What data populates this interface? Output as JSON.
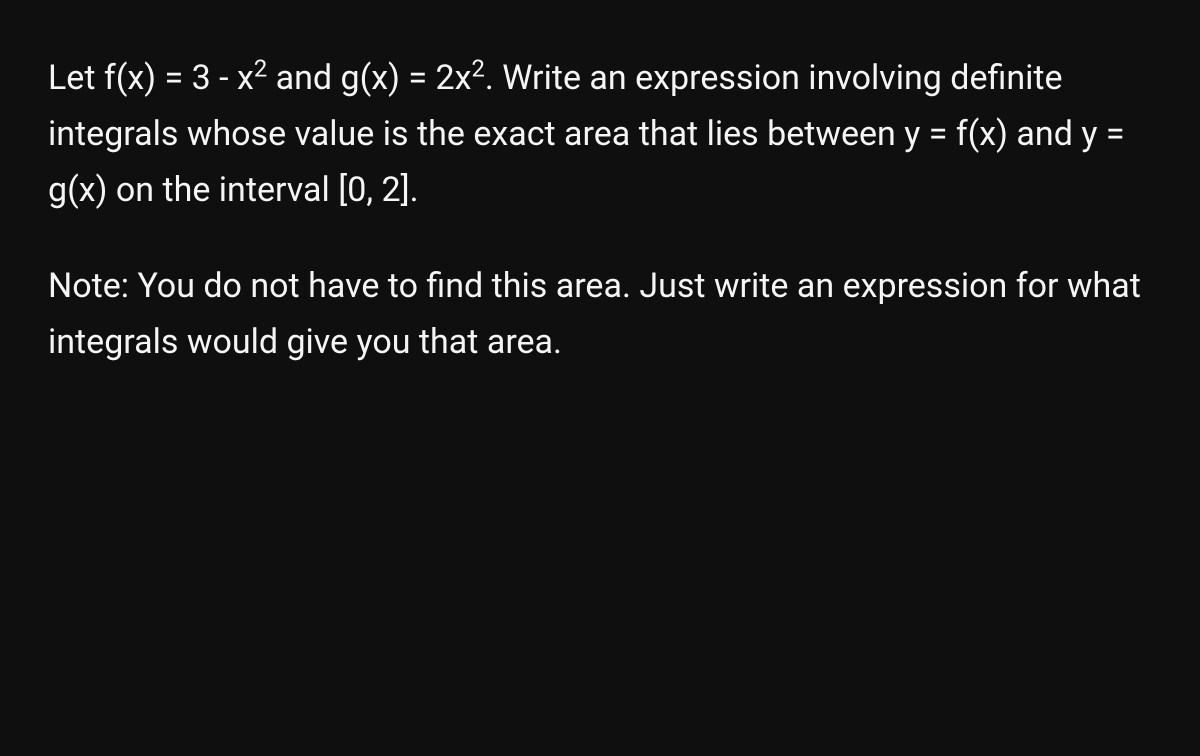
{
  "problem": {
    "p1_part1": "Let f(x) = 3 - x",
    "p1_sup1": "2",
    "p1_part2": " and g(x) = 2x",
    "p1_sup2": "2",
    "p1_part3": ". Write an expression involving definite integrals whose value is the exact area that lies between y = f(x) and y = g(x) on the interval [0, 2].",
    "p2": "Note: You do not have to find this area. Just write an expression for what integrals would give you that area."
  }
}
